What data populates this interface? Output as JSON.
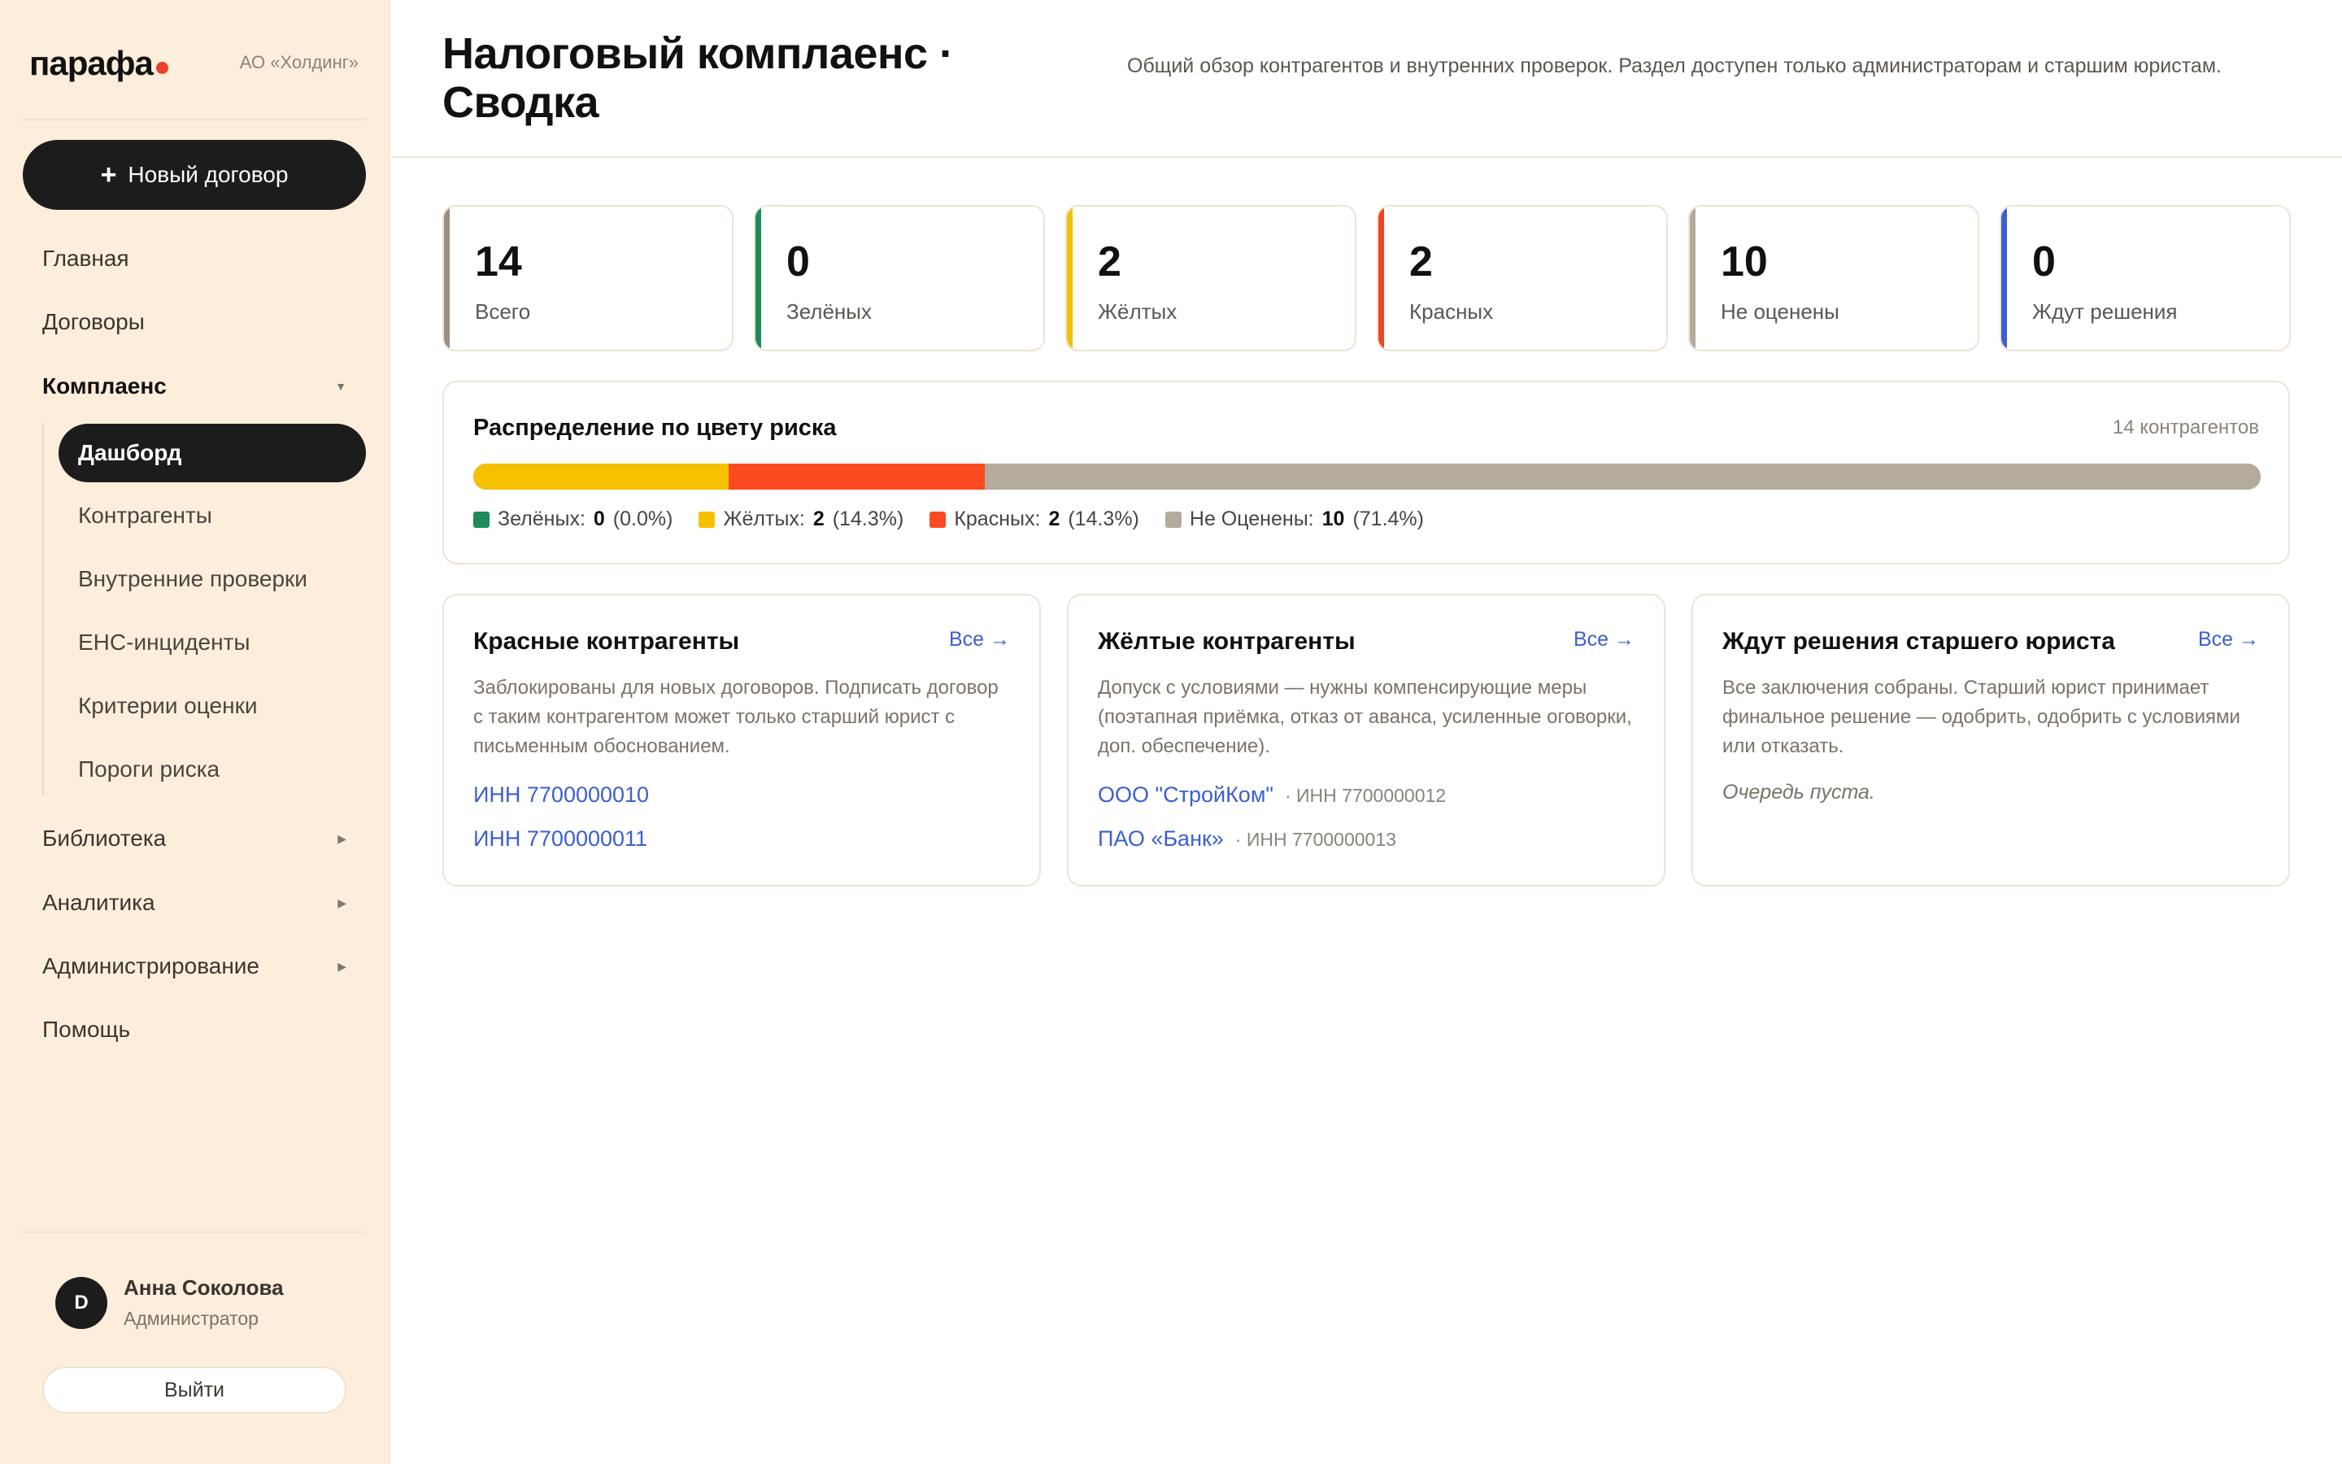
{
  "sidebar": {
    "logo": "парафа",
    "org": "АО «Холдинг»",
    "new_contract": "Новый договор",
    "nav": {
      "home": "Главная",
      "contracts": "Договоры",
      "compliance": "Комплаенс",
      "library": "Библиотека",
      "analytics": "Аналитика",
      "admin": "Администрирование",
      "help": "Помощь"
    },
    "sub": {
      "dashboard": "Дашборд",
      "counterparties": "Контрагенты",
      "internal_checks": "Внутренние проверки",
      "ens": "ЕНС-инциденты",
      "criteria": "Критерии оценки",
      "thresholds": "Пороги риска"
    },
    "user": {
      "initial": "D",
      "name": "Анна Соколова",
      "role": "Администратор",
      "logout": "Выйти"
    }
  },
  "header": {
    "title": "Налоговый комплаенс · Сводка",
    "description": "Общий обзор контрагентов и внутренних проверок. Раздел доступен только администраторам и старшим юристам."
  },
  "stats": [
    {
      "value": "14",
      "label": "Всего",
      "color": "#9a8f80"
    },
    {
      "value": "0",
      "label": "Зелёных",
      "color": "#1f8a5a"
    },
    {
      "value": "2",
      "label": "Жёлтых",
      "color": "#f2c200"
    },
    {
      "value": "2",
      "label": "Красных",
      "color": "#f04525"
    },
    {
      "value": "10",
      "label": "Не оценены",
      "color": "#b4ab9d"
    },
    {
      "value": "0",
      "label": "Ждут решения",
      "color": "#3d5fcf"
    }
  ],
  "distribution": {
    "title": "Распределение по цвету риска",
    "count": "14 контрагентов",
    "legend": [
      {
        "label": "Зелёных:",
        "value": "0",
        "pct": "(0.0%)",
        "color": "#1f8a5a",
        "fraction": 0.0
      },
      {
        "label": "Жёлтых:",
        "value": "2",
        "pct": "(14.3%)",
        "color": "#f5c000",
        "fraction": 0.143
      },
      {
        "label": "Красных:",
        "value": "2",
        "pct": "(14.3%)",
        "color": "#fb4a22",
        "fraction": 0.143
      },
      {
        "label": "Не Оценены:",
        "value": "10",
        "pct": "(71.4%)",
        "color": "#b4ab9d",
        "fraction": 0.714
      }
    ]
  },
  "panels": {
    "red": {
      "title": "Красные контрагенты",
      "all": "Все →",
      "desc": "Заблокированы для новых договоров. Подписать договор с таким контрагентом может только старший юрист с письменным обоснованием.",
      "items": [
        {
          "name": "ИНН 7700000010"
        },
        {
          "name": "ИНН 7700000011"
        }
      ]
    },
    "yellow": {
      "title": "Жёлтые контрагенты",
      "all": "Все →",
      "desc": "Допуск с условиями — нужны компенсирующие меры (поэтапная приёмка, отказ от аванса, усиленные оговорки, доп. обеспечение).",
      "items": [
        {
          "name": "ООО \"СтройКом\"",
          "inn": "· ИНН 7700000012"
        },
        {
          "name": "ПАО «Банк»",
          "inn": "· ИНН 7700000013"
        }
      ]
    },
    "pending": {
      "title": "Ждут решения старшего юриста",
      "all": "Все →",
      "desc": "Все заключения собраны. Старший юрист принимает финальное решение — одобрить, одобрить с условиями или отказать.",
      "empty": "Очередь пуста."
    }
  }
}
